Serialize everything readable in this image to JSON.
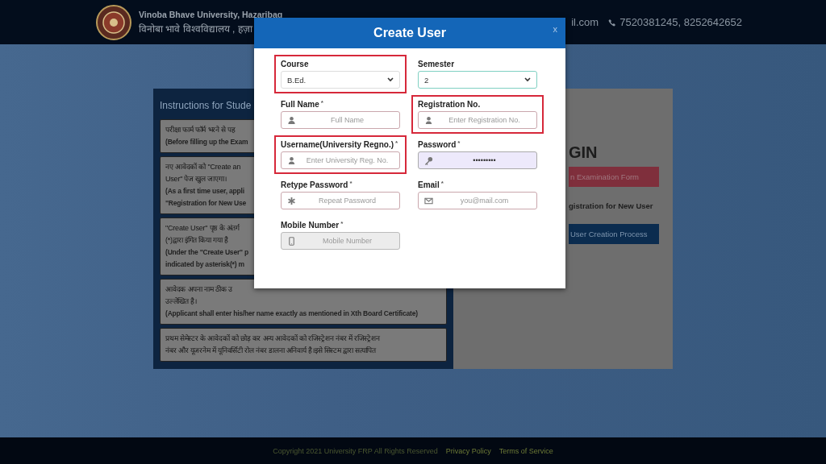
{
  "header": {
    "university_name": "Vinoba Bhave University, Hazaribag",
    "university_name_hindi": "विनोबा भावे विश्वविद्यालय , हज़ा",
    "email": "il.com",
    "phone": "7520381245, 8252642652"
  },
  "instructions": {
    "title": "Instructions for Stude",
    "items": [
      {
        "lines": [
          "परीक्षा फार्म फॉर्म भरने से पह"
        ],
        "english": [
          "(Before filling up the Exam"
        ]
      },
      {
        "lines": [
          "नए आवेदकों को \"Create an",
          "User\" पेज खुल जाएगा।"
        ],
        "english": [
          "(As a first time user, appli",
          "\"Registration for New Use"
        ]
      },
      {
        "lines": [
          "\"Create User\" पृष्ठ के अंतर्ग",
          "(*)द्वारा इंगित किया गया है"
        ],
        "english": [
          "(Under the \"Create User\" p",
          "indicated by asterisk(*) m"
        ]
      },
      {
        "lines": [
          "आवेदक अपना नाम ठीक उ",
          "उल्लेखित है।"
        ],
        "english": [
          "(Applicant shall enter his/her name exactly as mentioned in Xth Board Certificate)"
        ]
      },
      {
        "lines": [
          "प्रथम सेमेस्टर के आवेदकों को छोड़ कर अन्य आवेदकों को रजिस्ट्रेशन नंबर में रजिस्ट्रेशन",
          "नंबर और यूजरनेम में यूनिवर्सिटी रोल नंबर डालना अनिवार्य है।इसे सिस्टम द्वारा सत्यापित"
        ]
      }
    ]
  },
  "login": {
    "title": "GIN",
    "exam_button": "n Examination Form",
    "registration_text": "gistration for New User",
    "process_button": "User Creation Process"
  },
  "modal": {
    "title": "Create User",
    "close": "x",
    "fields": [
      {
        "kind": "select",
        "label": "Course",
        "highlighted": true,
        "focused": false,
        "value": "B.Ed."
      },
      {
        "kind": "select",
        "label": "Semester",
        "highlighted": false,
        "focused": true,
        "value": "2"
      },
      {
        "kind": "name",
        "label": "Full Name",
        "required_mark": "*",
        "highlighted": false,
        "placeholder": "Full Name",
        "filled": false,
        "disabled": false
      },
      {
        "kind": "user",
        "label": "Registration No.",
        "highlighted": true,
        "placeholder": "Enter Registration No.",
        "filled": false,
        "disabled": false
      },
      {
        "kind": "user",
        "label": "Username(University Regno.)",
        "required_mark": "*",
        "highlighted": true,
        "placeholder": "Enter University Reg. No.",
        "filled": false,
        "disabled": false
      },
      {
        "kind": "password",
        "label": "Password",
        "required_mark": "*",
        "highlighted": false,
        "value": "•••••••••",
        "filled": true,
        "disabled": false
      },
      {
        "kind": "retype",
        "label": "Retype Password",
        "required_mark": "*",
        "highlighted": false,
        "placeholder": "Repeat Password",
        "filled": false,
        "disabled": false
      },
      {
        "kind": "email",
        "label": "Email",
        "required_mark": "*",
        "highlighted": false,
        "placeholder": "you@mail.com",
        "filled": false,
        "disabled": false
      },
      {
        "kind": "mobile",
        "label": "Mobile Number",
        "required_mark": "*",
        "highlighted": false,
        "placeholder": "Mobile Number",
        "filled": false,
        "disabled": true
      }
    ]
  },
  "footer": {
    "copyright": "Copyright 2021 University FRP All Rights Reserved",
    "links": [
      "Privacy Policy",
      "Terms of Service"
    ]
  }
}
